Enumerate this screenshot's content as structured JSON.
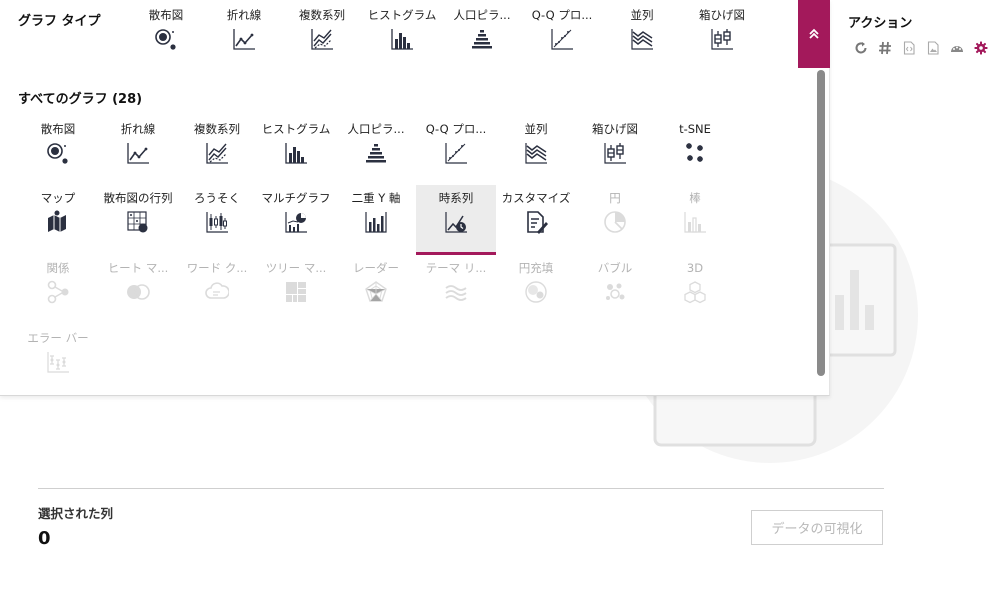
{
  "strip": {
    "title": "グラフ タイプ",
    "items": [
      {
        "label": "散布図",
        "icon": "scatter-icon"
      },
      {
        "label": "折れ線",
        "icon": "line-chart-icon"
      },
      {
        "label": "複数系列",
        "icon": "multi-series-icon"
      },
      {
        "label": "ヒストグラム",
        "icon": "histogram-icon"
      },
      {
        "label": "人口ピラ...",
        "icon": "pyramid-icon"
      },
      {
        "label": "Q-Q プロ...",
        "icon": "qq-plot-icon"
      },
      {
        "label": "並列",
        "icon": "parallel-icon"
      },
      {
        "label": "箱ひげ図",
        "icon": "boxplot-icon"
      }
    ]
  },
  "all_graphs": {
    "title": "すべてのグラフ (28)",
    "items": [
      {
        "label": "散布図",
        "icon": "scatter-icon",
        "disabled": false,
        "selected": false
      },
      {
        "label": "折れ線",
        "icon": "line-chart-icon",
        "disabled": false,
        "selected": false
      },
      {
        "label": "複数系列",
        "icon": "multi-series-icon",
        "disabled": false,
        "selected": false
      },
      {
        "label": "ヒストグラム",
        "icon": "histogram-icon",
        "disabled": false,
        "selected": false
      },
      {
        "label": "人口ピラ...",
        "icon": "pyramid-icon",
        "disabled": false,
        "selected": false
      },
      {
        "label": "Q-Q プロ...",
        "icon": "qq-plot-icon",
        "disabled": false,
        "selected": false
      },
      {
        "label": "並列",
        "icon": "parallel-icon",
        "disabled": false,
        "selected": false
      },
      {
        "label": "箱ひげ図",
        "icon": "boxplot-icon",
        "disabled": false,
        "selected": false
      },
      {
        "label": "t-SNE",
        "icon": "tsne-icon",
        "disabled": false,
        "selected": false
      },
      {
        "label": "マップ",
        "icon": "map-icon",
        "disabled": false,
        "selected": false
      },
      {
        "label": "散布図の行列",
        "icon": "scatter-matrix-icon",
        "disabled": false,
        "selected": false
      },
      {
        "label": "ろうそく",
        "icon": "candlestick-icon",
        "disabled": false,
        "selected": false
      },
      {
        "label": "マルチグラフ",
        "icon": "multigraph-icon",
        "disabled": false,
        "selected": false
      },
      {
        "label": "二重 Y 軸",
        "icon": "dual-axis-icon",
        "disabled": false,
        "selected": false
      },
      {
        "label": "時系列",
        "icon": "time-series-icon",
        "disabled": false,
        "selected": true
      },
      {
        "label": "カスタマイズ",
        "icon": "customize-icon",
        "disabled": false,
        "selected": false
      },
      {
        "label": "円",
        "icon": "pie-icon",
        "disabled": true,
        "selected": false
      },
      {
        "label": "棒",
        "icon": "bar-icon",
        "disabled": true,
        "selected": false
      },
      {
        "label": "関係",
        "icon": "relationship-icon",
        "disabled": true,
        "selected": false
      },
      {
        "label": "ヒート マ...",
        "icon": "heatmap-icon",
        "disabled": true,
        "selected": false
      },
      {
        "label": "ワード ク...",
        "icon": "word-cloud-icon",
        "disabled": true,
        "selected": false
      },
      {
        "label": "ツリー マ...",
        "icon": "treemap-icon",
        "disabled": true,
        "selected": false
      },
      {
        "label": "レーダー",
        "icon": "radar-icon",
        "disabled": true,
        "selected": false
      },
      {
        "label": "テーマ リ...",
        "icon": "theme-river-icon",
        "disabled": true,
        "selected": false
      },
      {
        "label": "円充填",
        "icon": "circle-packing-icon",
        "disabled": true,
        "selected": false
      },
      {
        "label": "バブル",
        "icon": "bubble-icon",
        "disabled": true,
        "selected": false
      },
      {
        "label": "3D",
        "icon": "3d-icon",
        "disabled": true,
        "selected": false
      },
      {
        "label": "エラー バー",
        "icon": "error-bar-icon",
        "disabled": true,
        "selected": false
      }
    ]
  },
  "actions": {
    "title": "アクション",
    "icons": [
      "refresh-icon",
      "hash-icon",
      "code-file-icon",
      "image-file-icon",
      "dashboard-icon",
      "gear-icon"
    ]
  },
  "selected_columns": {
    "label": "選択された列",
    "count": "0"
  },
  "visualize_button": "データの可視化",
  "colors": {
    "accent": "#a3195b",
    "icon": "#2b3040",
    "disabled": "#b3b3b3"
  }
}
